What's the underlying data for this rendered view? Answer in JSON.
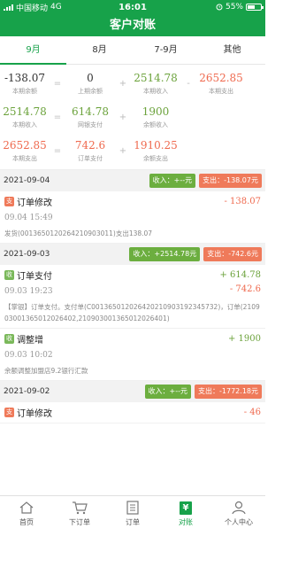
{
  "status_bar": {
    "carrier": "中国移动",
    "network": "4G",
    "time": "16:01",
    "battery": "55%"
  },
  "title": "客户对账",
  "tabs": [
    {
      "label": "9月",
      "active": true
    },
    {
      "label": "8月",
      "active": false
    },
    {
      "label": "7-9月",
      "active": false
    },
    {
      "label": "其他",
      "active": false
    }
  ],
  "summary": {
    "row1": {
      "a": {
        "value": "-138.07",
        "label": "本期余额"
      },
      "op1": "=",
      "b": {
        "value": "0",
        "label": "上期余额"
      },
      "op2": "+",
      "c": {
        "value": "2514.78",
        "label": "本期收入"
      },
      "op3": "-",
      "d": {
        "value": "2652.85",
        "label": "本期支出"
      }
    },
    "row2": {
      "a": {
        "value": "2514.78",
        "label": "本期收入"
      },
      "op1": "=",
      "b": {
        "value": "614.78",
        "label": "网银支付"
      },
      "op2": "+",
      "c": {
        "value": "1900",
        "label": "余额收入"
      }
    },
    "row3": {
      "a": {
        "value": "2652.85",
        "label": "本期支出"
      },
      "op1": "=",
      "b": {
        "value": "742.6",
        "label": "订单支付"
      },
      "op2": "+",
      "c": {
        "value": "1910.25",
        "label": "余额支出"
      }
    }
  },
  "days": [
    {
      "date": "2021-09-04",
      "income": "收入：+--元",
      "expense": "支出：-138.07元",
      "entries": [
        {
          "tag": "支",
          "type": "out",
          "title": "订单修改",
          "amount": "- 138.07",
          "time": "09.04 15:49",
          "note": "发货(0013650120264210903011)支出138.07"
        }
      ]
    },
    {
      "date": "2021-09-03",
      "income": "收入：+2514.78元",
      "expense": "支出：-742.6元",
      "entries": [
        {
          "tag": "收",
          "type": "in",
          "title": "订单支付",
          "amount": "+ 614.78",
          "amount2": "- 742.6",
          "time": "09.03 19:23",
          "note": "【掌银】订单支付。支付单(C0013650120264202109031923457​32)，订单(210903001365012026402,210903001365012026401)"
        },
        {
          "tag": "收",
          "type": "in",
          "title": "调整增",
          "amount": "+ 1900",
          "time": "09.03 10:02",
          "note": "余额调整加盟店9.2银行汇款"
        }
      ]
    },
    {
      "date": "2021-09-02",
      "income": "收入：+--元",
      "expense": "支出：-1772.18元",
      "entries": [
        {
          "tag": "支",
          "type": "out",
          "title": "订单修改",
          "amount": "- 46"
        }
      ]
    }
  ],
  "tabbar": [
    {
      "label": "首页",
      "icon": "home-icon",
      "active": false
    },
    {
      "label": "下订单",
      "icon": "cart-icon",
      "active": false
    },
    {
      "label": "订单",
      "icon": "list-icon",
      "active": false
    },
    {
      "label": "对账",
      "icon": "yen-icon",
      "glyph": "¥",
      "active": true
    },
    {
      "label": "个人中心",
      "icon": "user-icon",
      "active": false
    }
  ],
  "colors": {
    "brand_green": "#17a24a",
    "income": "#6cae3f",
    "expense": "#ef7a5a"
  }
}
